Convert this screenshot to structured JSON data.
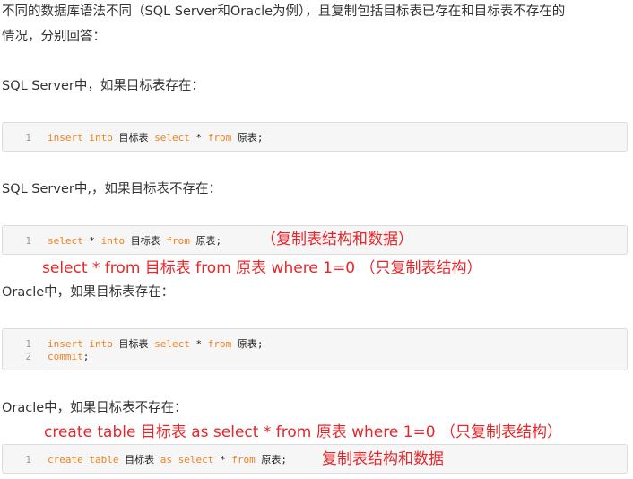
{
  "para1": "不同的数据库语法不同（SQL Server和Oracle为例），且复制包括目标表已存在和目标表不存在的",
  "para2": "情况，分别回答：",
  "h1": "SQL Server中，如果目标表存在：",
  "h2": "SQL Server中,，如果目标表不存在：",
  "h3": "Oracle中，如果目标表存在：",
  "h4": "Oracle中，如果目标表不存在：",
  "code1": {
    "ln": "1",
    "t1": "insert into",
    "t2": " 目标表 ",
    "t3": "select",
    "t4": " * ",
    "t5": "from",
    "t6": " 原表;"
  },
  "code2": {
    "ln": "1",
    "t1": "select",
    "t2": " * ",
    "t3": "into",
    "t4": " 目标表 ",
    "t5": "from",
    "t6": " 原表;",
    "note": "（复制表结构和数据）"
  },
  "red1": "select * from 目标表 from 原表 where 1=0 （只复制表结构）",
  "code3": {
    "ln1": "1",
    "ln2": "2",
    "t1": "insert into",
    "t2": " 目标表 ",
    "t3": "select",
    "t4": " * ",
    "t5": "from",
    "t6": " 原表;",
    "t7": "commit",
    "t8": ";"
  },
  "red2": "create table 目标表 as select * from 原表  where 1=0 （只复制表结构）",
  "code4": {
    "ln": "1",
    "t1": "create table",
    "t2": " 目标表 ",
    "t3": "as",
    "t4": " ",
    "t5": "select",
    "t6": " * ",
    "t7": "from",
    "t8": " 原表;",
    "note": "复制表结构和数据"
  },
  "colors": {
    "keyword": "#f0821e",
    "annotation": "#e8262a",
    "codeBg": "#f6f6f6"
  }
}
